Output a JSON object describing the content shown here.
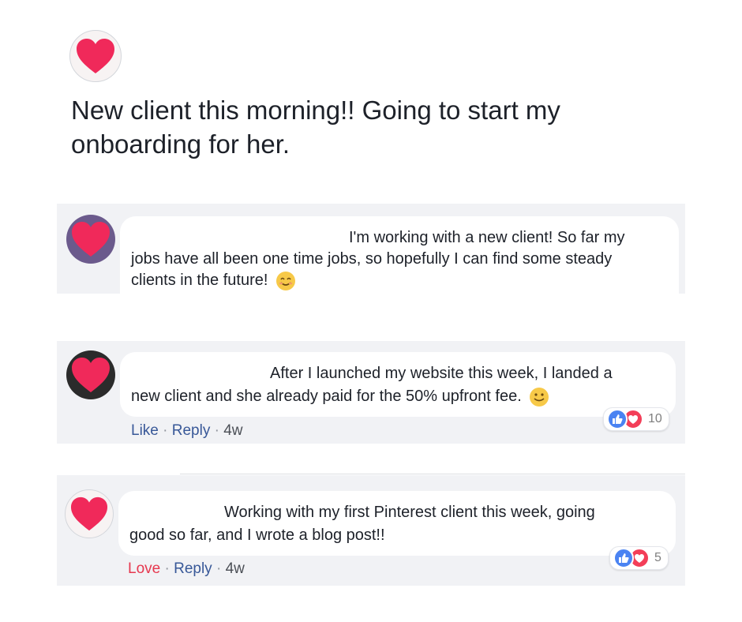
{
  "post": {
    "text_line_1": "New client this morning!! Going to start my",
    "text_line_2": "onboarding for her."
  },
  "comments": [
    {
      "lines": [
        "I'm working with a new client! So far my",
        "jobs have all been one time jobs, so hopefully I can find some steady",
        "clients in the future!"
      ],
      "emoji": "smiling-face-icon"
    },
    {
      "lines": [
        "After I launched my website this week, I landed a",
        "new client and she already paid for the 50% upfront fee."
      ],
      "emoji": "slight-smile-icon",
      "actions": {
        "first": "Like",
        "sep": "·",
        "reply": "Reply",
        "time": "4w"
      },
      "reaction_count": "10"
    },
    {
      "lines": [
        "Working with my first Pinterest client this week, going",
        "good so far, and I wrote a blog post!!"
      ],
      "actions": {
        "first": "Love",
        "sep": "·",
        "reply": "Reply",
        "time": "4w"
      },
      "reaction_count": "5"
    }
  ],
  "colors": {
    "heart": "#f0295a",
    "like_blue": "#4a83f2",
    "love_red": "#f33e58",
    "link_blue": "#385898",
    "panel_gray": "#f1f2f5"
  }
}
